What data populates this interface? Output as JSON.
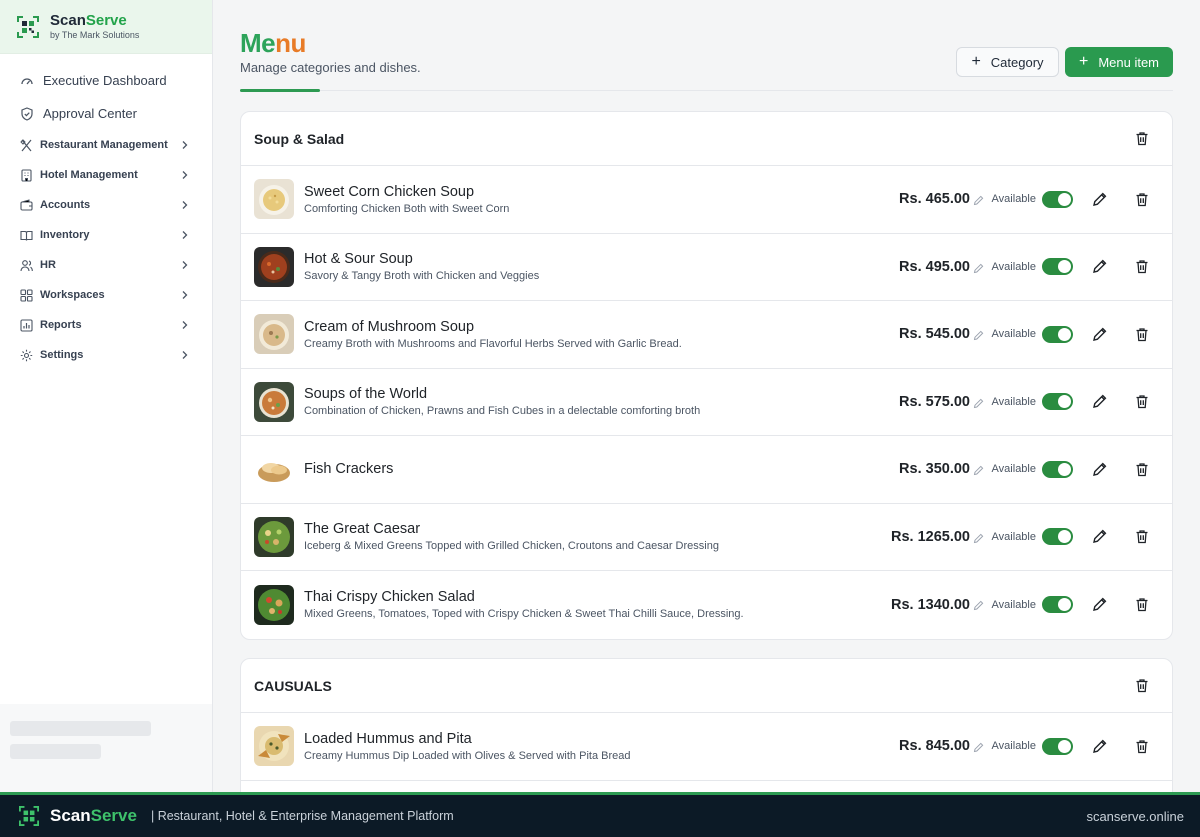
{
  "brand": {
    "name_part1": "Scan",
    "name_part2": "Serve",
    "sub": "by The Mark Solutions"
  },
  "sidebar": {
    "top_items": [
      {
        "label": "Executive Dashboard",
        "icon": "dashboard-icon"
      },
      {
        "label": "Approval Center",
        "icon": "shield-check-icon"
      }
    ],
    "items": [
      {
        "label": "Restaurant Management",
        "icon": "utensils-icon"
      },
      {
        "label": "Hotel Management",
        "icon": "building-icon"
      },
      {
        "label": "Accounts",
        "icon": "wallet-icon"
      },
      {
        "label": "Inventory",
        "icon": "book-icon"
      },
      {
        "label": "HR",
        "icon": "users-icon"
      },
      {
        "label": "Workspaces",
        "icon": "grid-icon"
      },
      {
        "label": "Reports",
        "icon": "chart-icon"
      },
      {
        "label": "Settings",
        "icon": "gear-icon"
      }
    ]
  },
  "header": {
    "title_part1": "Me",
    "title_part2": "nu",
    "subtitle": "Manage categories and dishes.",
    "category_button": "Category",
    "menu_item_button": "Menu item"
  },
  "labels": {
    "available": "Available"
  },
  "categories": [
    {
      "name": "Soup & Salad",
      "dishes": [
        {
          "name": "Sweet Corn Chicken Soup",
          "desc": "Comforting Chicken Both with Sweet Corn",
          "price": "Rs. 465.00",
          "available": true
        },
        {
          "name": "Hot & Sour Soup",
          "desc": "Savory & Tangy Broth with Chicken and Veggies",
          "price": "Rs. 495.00",
          "available": true
        },
        {
          "name": "Cream of Mushroom Soup",
          "desc": "Creamy Broth with Mushrooms and Flavorful Herbs Served with Garlic Bread.",
          "price": "Rs. 545.00",
          "available": true
        },
        {
          "name": "Soups of the World",
          "desc": "Combination of Chicken, Prawns and Fish Cubes in a delectable comforting broth",
          "price": "Rs. 575.00",
          "available": true
        },
        {
          "name": "Fish Crackers",
          "desc": "",
          "price": "Rs. 350.00",
          "available": true
        },
        {
          "name": "The Great Caesar",
          "desc": "Iceberg & Mixed Greens Topped with Grilled Chicken, Croutons and Caesar Dressing",
          "price": "Rs. 1265.00",
          "available": true
        },
        {
          "name": "Thai Crispy Chicken Salad",
          "desc": "Mixed Greens, Tomatoes, Toped with Crispy Chicken & Sweet Thai Chilli Sauce, Dressing.",
          "price": "Rs. 1340.00",
          "available": true
        }
      ]
    },
    {
      "name": "CAUSUALS",
      "dishes": [
        {
          "name": "Loaded Hummus and Pita",
          "desc": "Creamy Hummus Dip Loaded with Olives & Served with Pita Bread",
          "price": "Rs. 845.00",
          "available": true
        }
      ]
    }
  ],
  "bottom_bar": {
    "name_part1": "Scan",
    "name_part2": "Serve",
    "tagline": "| Restaurant, Hotel & Enterprise Management Platform",
    "url": "scanserve.online"
  },
  "colors": {
    "accent": "#2a9a4f",
    "title_orange": "#e87b27",
    "toggle_on": "#2a8c40",
    "footer_bg": "#0c1a26"
  }
}
